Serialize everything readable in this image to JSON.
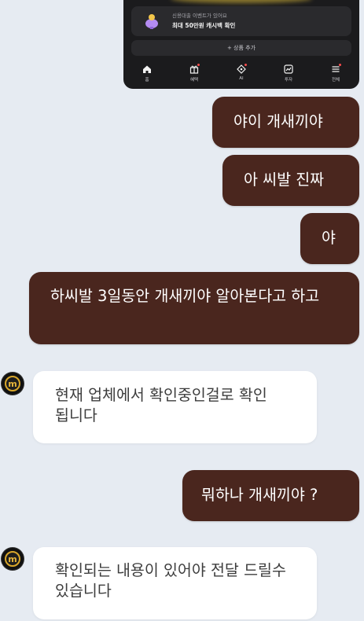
{
  "screenshot": {
    "promo": {
      "subtitle": "신용대출 이벤트가 있어요",
      "title": "최대 50만원 캐시백 확인"
    },
    "add_button": "+ 상품 추가",
    "tabs": [
      {
        "label": "홈",
        "icon": "home-icon"
      },
      {
        "label": "혜택",
        "icon": "gift-icon"
      },
      {
        "label": "AI",
        "icon": "ai-icon"
      },
      {
        "label": "투자",
        "icon": "chart-icon"
      },
      {
        "label": "전체",
        "icon": "menu-icon"
      }
    ]
  },
  "chat": {
    "avatar_letter": "m",
    "messages": [
      {
        "text": "야이 개새끼야"
      },
      {
        "text": "아 씨발 진짜"
      },
      {
        "text": "야"
      },
      {
        "text": "하씨발 3일동안 개새끼야 알아본다고 하고"
      },
      {
        "text": "현재 업체에서 확인중인걸로 확인 됩니다"
      },
      {
        "text": "뭐하나 개새끼야 ?"
      },
      {
        "text": "확인되는 내용이 있어야 전달 드릴수 있습니다"
      }
    ]
  },
  "colors": {
    "background": "#e6ebf2",
    "outgoing_bubble": "#4a261e",
    "incoming_bubble": "#ffffff",
    "avatar_ring": "#d8a62b"
  }
}
